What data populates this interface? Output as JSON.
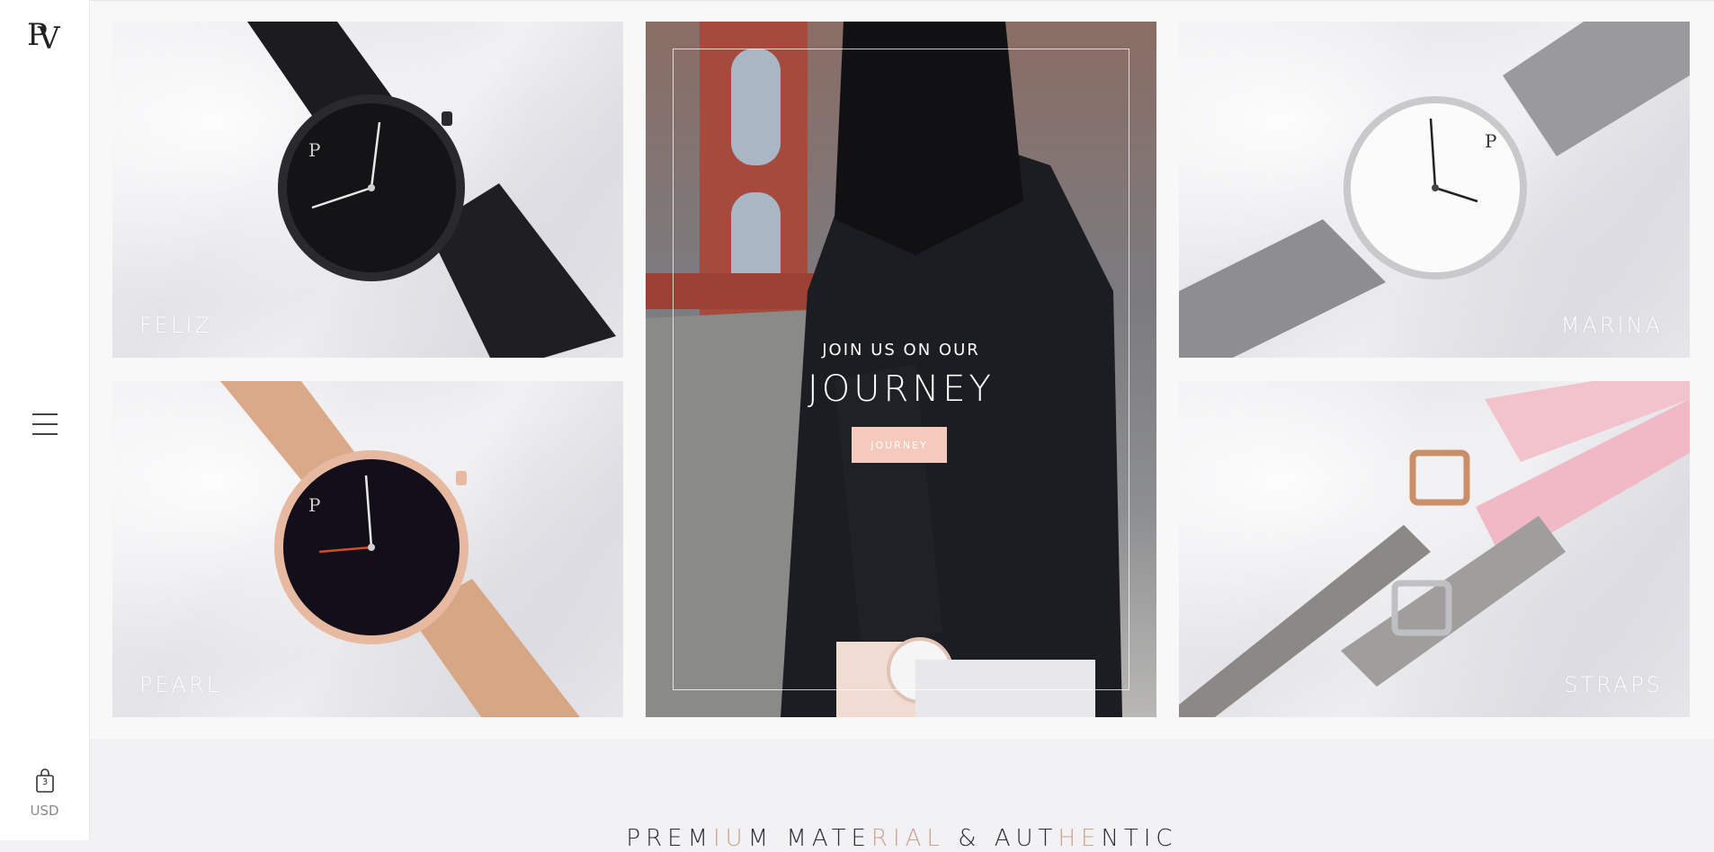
{
  "sidebar": {
    "logo_text": "PV",
    "bag_count": "3",
    "currency": "USD"
  },
  "tiles": {
    "feliz": "FELIZ",
    "pearl": "PEARL",
    "marina": "MARINA",
    "straps": "STRAPS"
  },
  "journey": {
    "subtitle": "JOIN US ON OUR",
    "title": "JOURNEY",
    "button_label": "JOURNEY"
  },
  "heading": {
    "part1": "PREM",
    "accent1": "IU",
    "part2": "M MATE",
    "accent2": "RIAL",
    "part3": " & AUT",
    "accent3": "HE",
    "part4": "NTIC"
  },
  "colors": {
    "accent": "#f6c9bd",
    "text_dark": "#2a2a3a"
  },
  "icons": [
    "pv-logo-icon",
    "hamburger-menu-icon",
    "shopping-bag-icon"
  ]
}
